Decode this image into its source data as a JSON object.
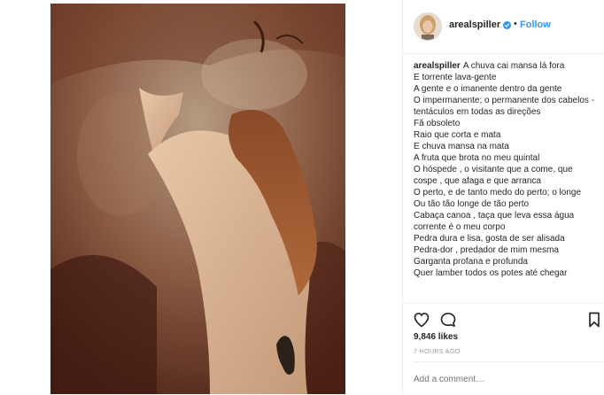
{
  "post": {
    "username": "arealspiller",
    "follow_label": "Follow",
    "separator": "•",
    "caption_author": "arealspiller",
    "caption_lines": [
      "A chuva cai mansa lá fora",
      "E torrente lava-gente",
      "A gente e o imanente dentro da gente",
      "O impermanente; o permanente dos cabelos - tentáculos em todas as direções",
      "Fã obsoleto",
      "Raio que corta e mata",
      "E chuva mansa na mata",
      "A fruta que brota no meu quintal",
      "O hóspede , o visitante que a come, que cospe , que afaga e que arranca",
      "O perto, e de tanto medo do perto; o longe",
      "Ou tão tão longe de tão perto",
      "Cabaça canoa , taça que leva essa água corrente é o meu corpo",
      "Pedra dura e lisa, gosta de ser alisada",
      "Pedra-dor , predador de mim mesma",
      "Garganta profana e profunda",
      "Quer lamber todos os potes até chegar"
    ],
    "likes": "9,846 likes",
    "time": "7 HOURS AGO",
    "comment_placeholder": "Add a comment…"
  },
  "icons": {
    "like": "heart-icon",
    "comment": "comment-bubble-icon",
    "save": "bookmark-icon",
    "verified": "verified-badge-icon"
  },
  "colors": {
    "link_blue": "#3897f0",
    "text": "#262626",
    "muted": "#999999",
    "border": "#efefef"
  }
}
